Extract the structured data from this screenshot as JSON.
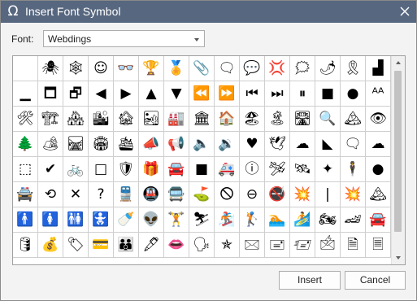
{
  "window": {
    "title": "Insert Font Symbol",
    "title_icon": "Ω"
  },
  "font": {
    "label": "Font:",
    "selected": "Webdings"
  },
  "grid": {
    "selected_index": 164,
    "symbols": [
      "",
      "🕷",
      "🕸",
      "☺",
      "👓",
      "🏆",
      "🏅",
      "📎",
      "🗨",
      "💬",
      "💢",
      "🗯",
      "🌶",
      "🎗",
      "▟",
      "▁",
      "🗖",
      "🗗",
      "◀",
      "▶",
      "▲",
      "▼",
      "⏪",
      "⏩",
      "⏮",
      "⏭",
      "⏸",
      "■",
      "●",
      "ᴬᴬ",
      "🛠",
      "🏗",
      "🏘",
      "🏙",
      "🏚",
      "🏜",
      "🏭",
      "🏛",
      "🏠",
      "🏖",
      "🏝",
      "🛣",
      "🔍",
      "🏔",
      "👁",
      "🌲",
      "🏕",
      "🛤",
      "🏟",
      "🛳",
      "📣",
      "📢",
      "🔈",
      "🔉",
      "♥",
      "🕊",
      "☁",
      "◣",
      "🗨",
      "☁",
      "⬚",
      "✔",
      "🚲",
      "□",
      "🛡",
      "🎁",
      "🚘",
      "■",
      "🚑",
      "ⓘ",
      "🛩",
      "🛰",
      "✦",
      "🕴",
      "●",
      "🚔",
      "⟲",
      "✕",
      "?",
      "🚆",
      "🚇",
      "🚍",
      "⛳",
      "🛇",
      "⊖",
      "🚭",
      "💥",
      "|",
      "💥",
      "🏔",
      "🚹",
      "🚺",
      "🚻",
      "🚼",
      "🍼",
      "👽",
      "🏋",
      "⛷",
      "🏂",
      "🏌",
      "🏊",
      "🏄",
      "🏍",
      "🏎",
      "🚘",
      "🛢",
      "💰",
      "🏷",
      "💳",
      "👪",
      "🖋",
      "👄",
      "🗣",
      "✯",
      "🖂",
      "🖃",
      "🖅",
      "🖄",
      "🗎",
      "🗏"
    ]
  },
  "buttons": {
    "insert": "Insert",
    "cancel": "Cancel"
  },
  "icons": {
    "close": "close-icon",
    "title": "omega-icon",
    "dropdown": "chevron-down-icon"
  }
}
